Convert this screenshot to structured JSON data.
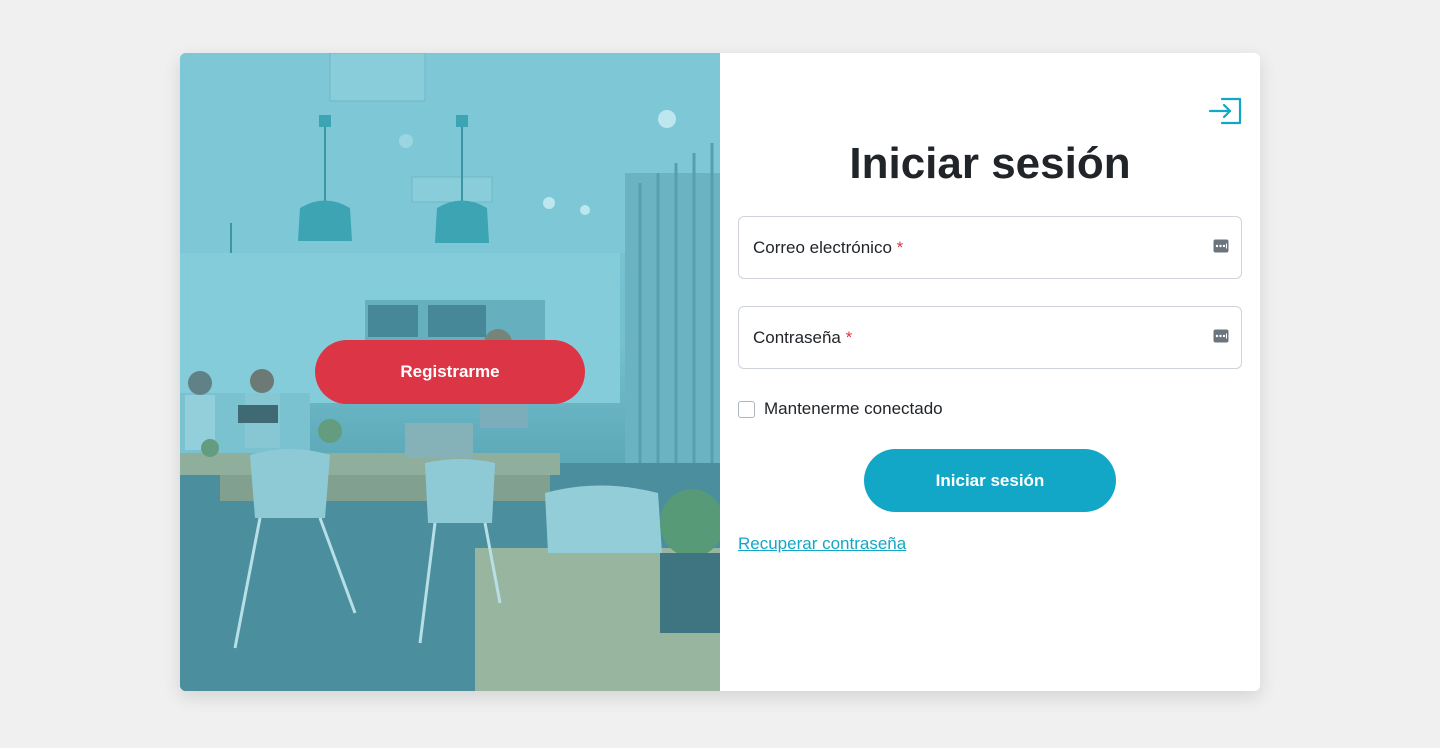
{
  "colors": {
    "page_background": "#f0f0f0",
    "register_button": "#dc3545",
    "login_button": "#13a7c7",
    "link": "#13a7c7",
    "required_asterisk": "#dc3545",
    "image_overlay": "#6fc3d4"
  },
  "left_panel": {
    "image": "office-lounge-photo",
    "register_label": "Registrarme"
  },
  "right_panel": {
    "header_icon": "login-icon",
    "title": "Iniciar sesión",
    "email": {
      "label": "Correo electrónico",
      "required_mark": "*",
      "value": "",
      "icon": "password-manager-key-icon"
    },
    "password": {
      "label": "Contraseña",
      "required_mark": "*",
      "value": "",
      "icon": "password-manager-key-icon"
    },
    "remember": {
      "label": "Mantenerme conectado",
      "checked": false
    },
    "login_label": "Iniciar sesión",
    "recover_label": "Recuperar contraseña"
  }
}
